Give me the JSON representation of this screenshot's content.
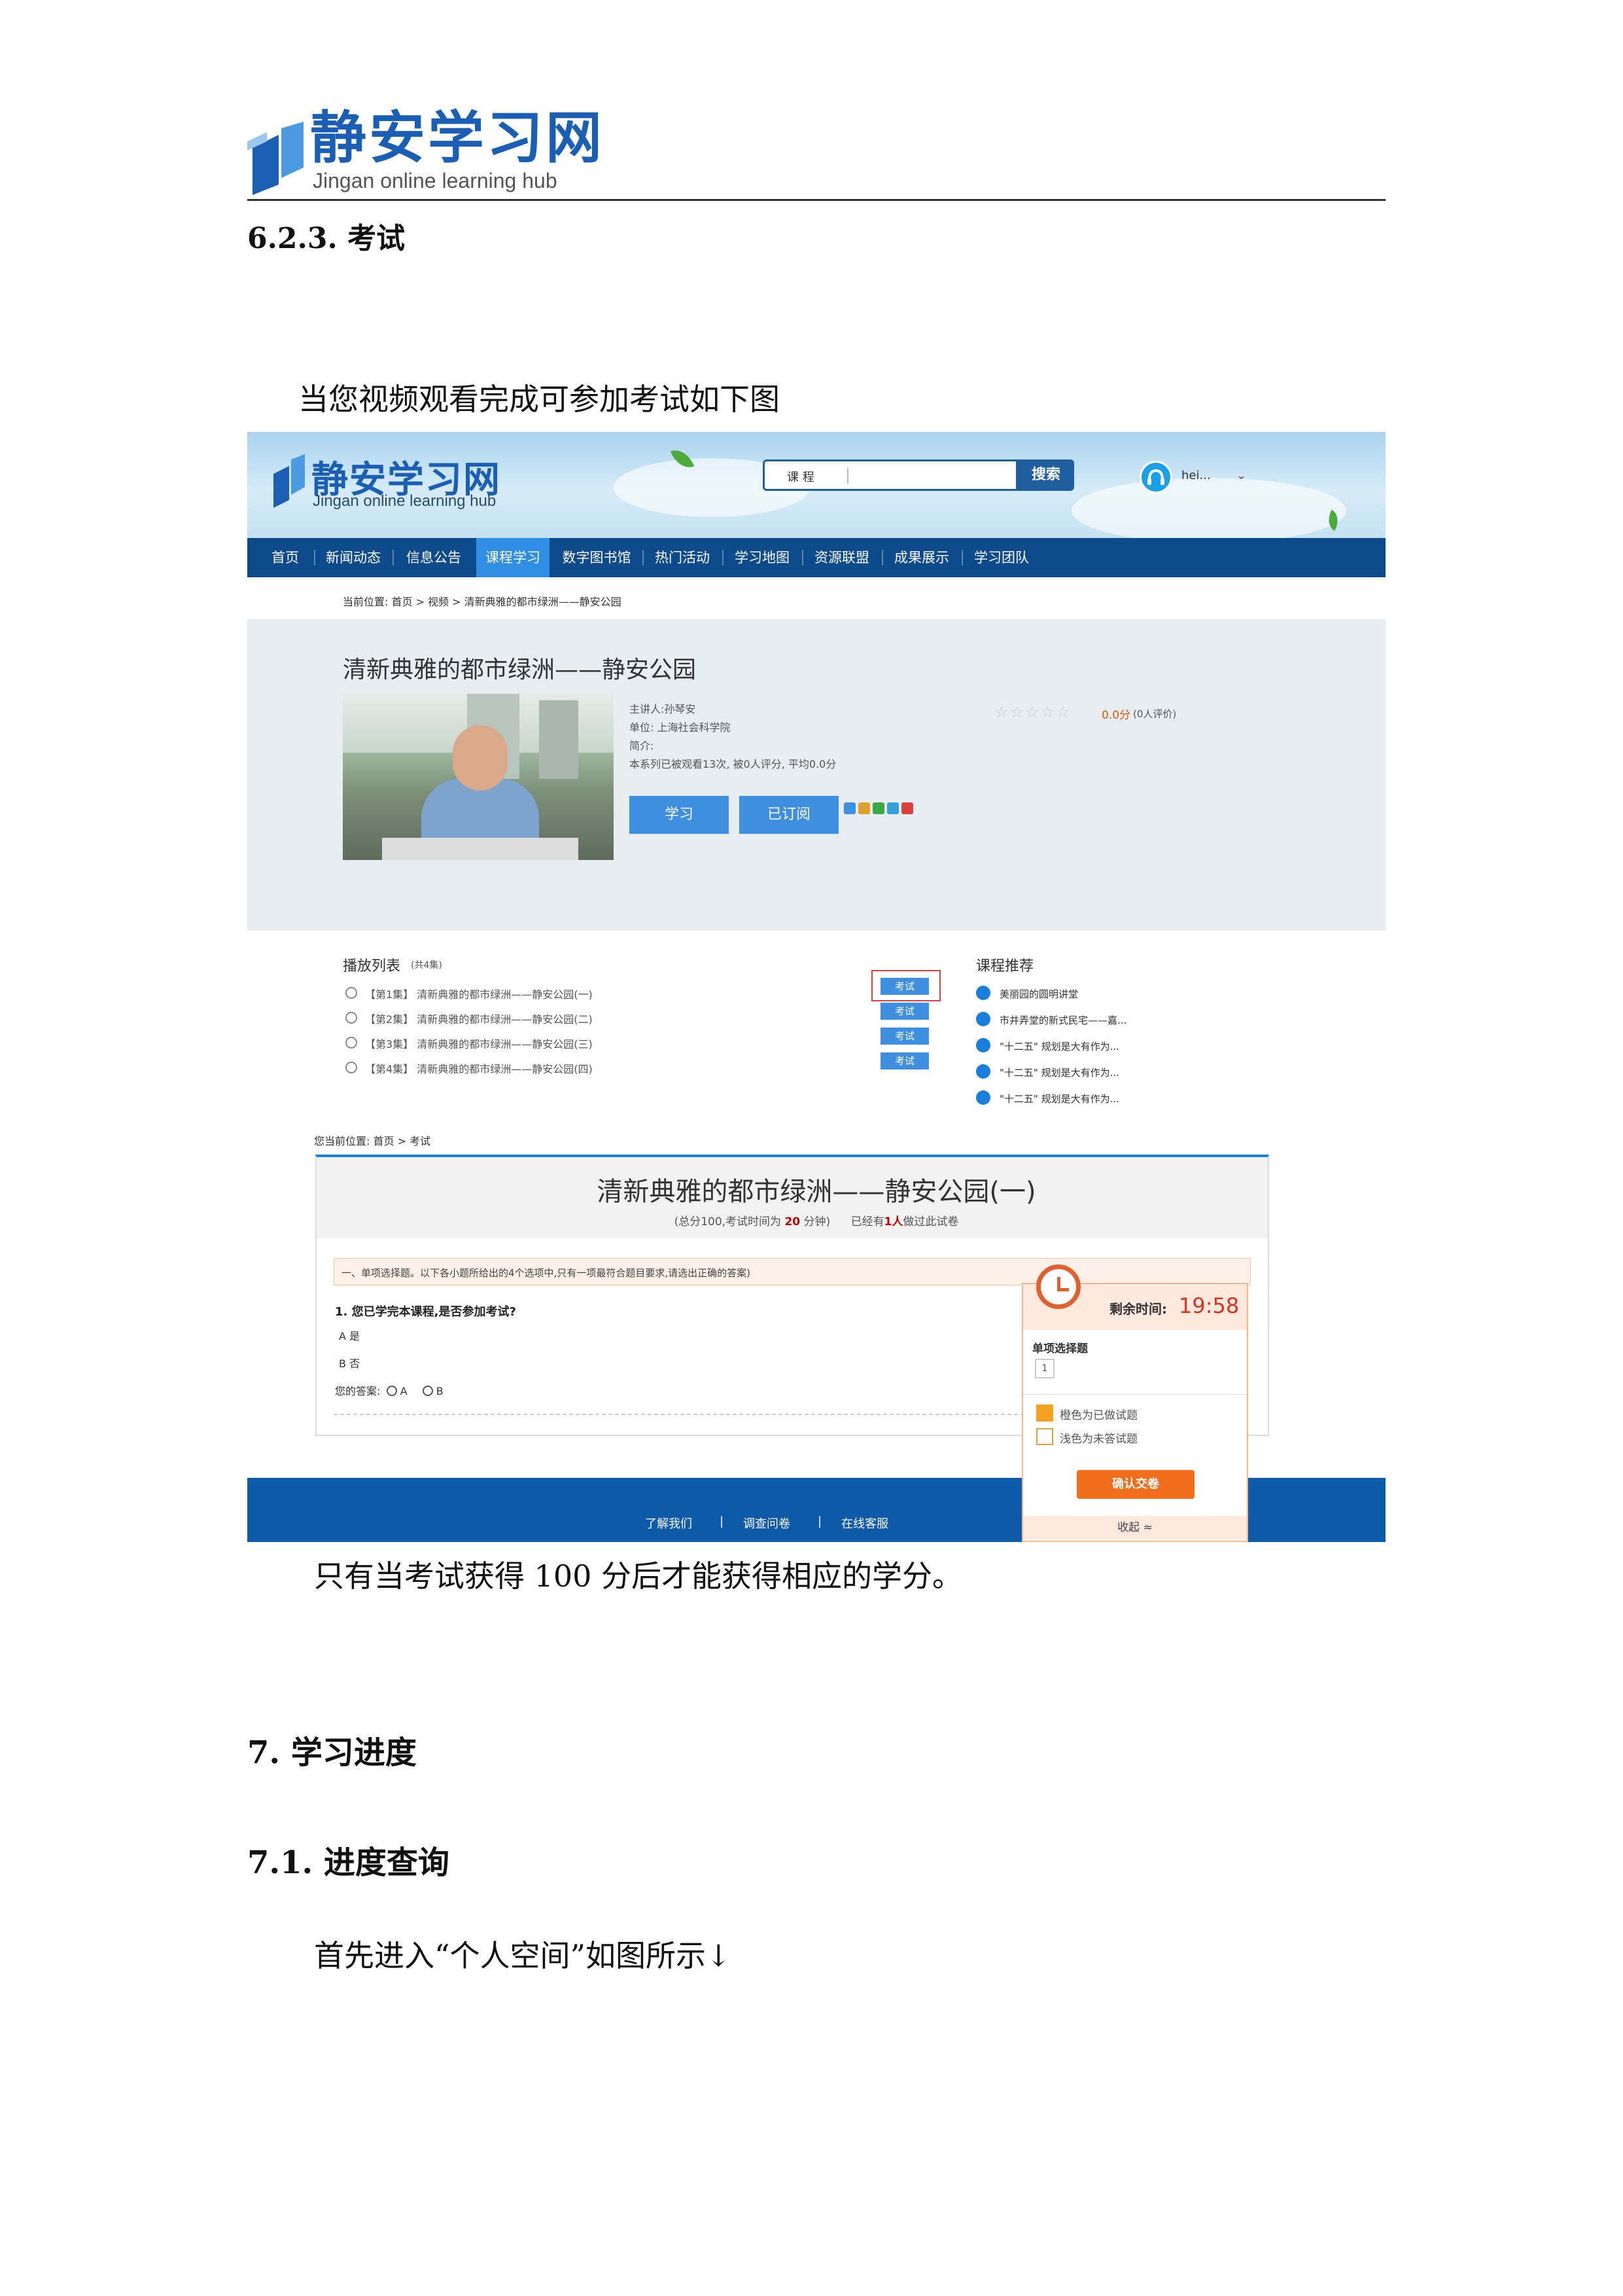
{
  "doc_header": {
    "logo_cn": "静安学习网",
    "logo_en": "Jingan online learning hub"
  },
  "section_623": "6.2.3. 考试",
  "intro_text": "当您视频观看完成可参加考试如下图",
  "screenshot": {
    "site_logo_cn": "静安学习网",
    "site_logo_en": "Jingan online learning hub",
    "search_value": "课 程",
    "search_button": "搜索",
    "user_name": "hei...",
    "nav": [
      "首页",
      "新闻动态",
      "信息公告",
      "课程学习",
      "数字图书馆",
      "热门活动",
      "学习地图",
      "资源联盟",
      "成果展示",
      "学习团队"
    ],
    "nav_active": "课程学习",
    "breadcrumb": "当前位置: 首页 > 视频 > 清新典雅的都市绿洲——静安公园",
    "course_title": "清新典雅的都市绿洲——静安公园",
    "lecturer": "主讲人:孙琴安",
    "unit": "单位: 上海社会科学院",
    "intro": "简介:",
    "stats": "本系列已被观看13次, 被0人评分, 平均0.0分",
    "btn_study": "学习",
    "btn_subscribed": "已订阅",
    "stars": "☆☆☆☆☆",
    "rating_value": "0.0分",
    "rating_count": "(0人评价)",
    "playlist_title": "播放列表",
    "playlist_count": "(共4集)",
    "playlist": [
      "【第1集】 清新典雅的都市绿洲——静安公园(一)",
      "【第2集】 清新典雅的都市绿洲——静安公园(二)",
      "【第3集】 清新典雅的都市绿洲——静安公园(三)",
      "【第4集】 清新典雅的都市绿洲——静安公园(四)"
    ],
    "exam_button": "考试",
    "recommend_title": "课程推荐",
    "recommend": [
      "美丽园的圆明讲堂",
      "市井弄堂的新式民宅——嘉...",
      "\"十二五\" 规划是大有作为...",
      "\"十二五\" 规划是大有作为...",
      "\"十二五\" 规划是大有作为..."
    ],
    "exam_crumb": "您当前位置: 首页 > 考试",
    "exam_title": "清新典雅的都市绿洲——静安公园(一)",
    "exam_meta_prefix": "(总分100,考试时间为",
    "exam_minutes": "20",
    "exam_meta_suffix": "分钟)",
    "exam_passed_prefix": "已经有",
    "exam_passed_count": "1人",
    "exam_passed_suffix": "做过此试卷",
    "section_instructions": "一、单项选择题。以下各小题所给出的4个选项中,只有一项最符合题目要求,请选出正确的答案)",
    "question": "1. 您已学完本课程,是否参加考试?",
    "option_a": "A  是",
    "option_b": "B  否",
    "answer_label": "您的答案:",
    "answer_a": "A",
    "answer_b": "B",
    "timer_label": "剩余时间:",
    "timer_value": "19:58",
    "panel_section": "单项选择题",
    "panel_num": "1",
    "legend_done": "橙色为已做试题",
    "legend_todo": "浅色为未答试题",
    "submit": "确认交卷",
    "collapse": "收起 ≈",
    "footer_links": [
      "了解我们",
      "调查问卷",
      "在线客服"
    ],
    "footer_sep": "|"
  },
  "note_text": "只有当考试获得 100 分后才能获得相应的学分。",
  "section_7": "7.  学习进度",
  "section_71": "7.1. 进度查询",
  "closing_text": "首先进入“个人空间”如图所示↓"
}
